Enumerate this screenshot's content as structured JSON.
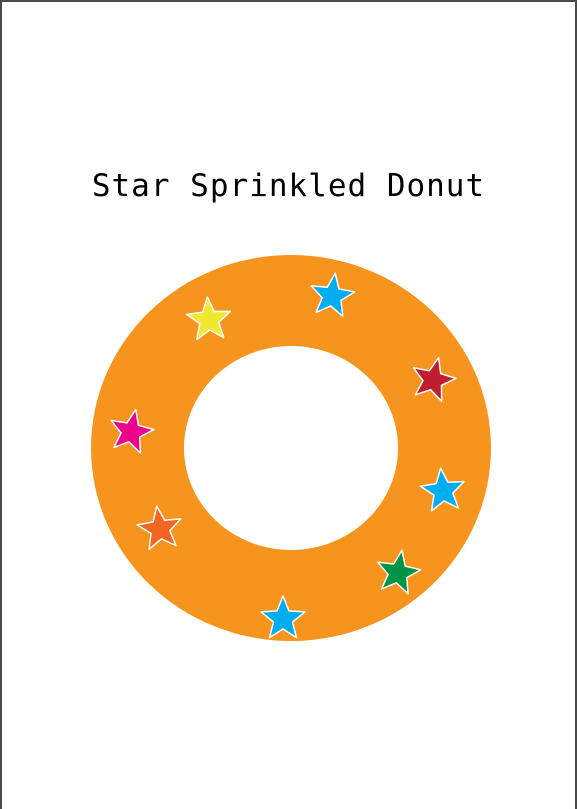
{
  "title": "Star Sprinkled Donut",
  "colors": {
    "dough": "#F7941E",
    "hole": "#FFFFFF",
    "star_outline": "#FFFFFF"
  },
  "sprinkles": [
    {
      "color": "#00AEEF"
    },
    {
      "color": "#BE1E2D"
    },
    {
      "color": "#00AEEF"
    },
    {
      "color": "#009444"
    },
    {
      "color": "#00AEEF"
    },
    {
      "color": "#F26522"
    },
    {
      "color": "#EC008C"
    },
    {
      "color": "#F2E832"
    }
  ]
}
